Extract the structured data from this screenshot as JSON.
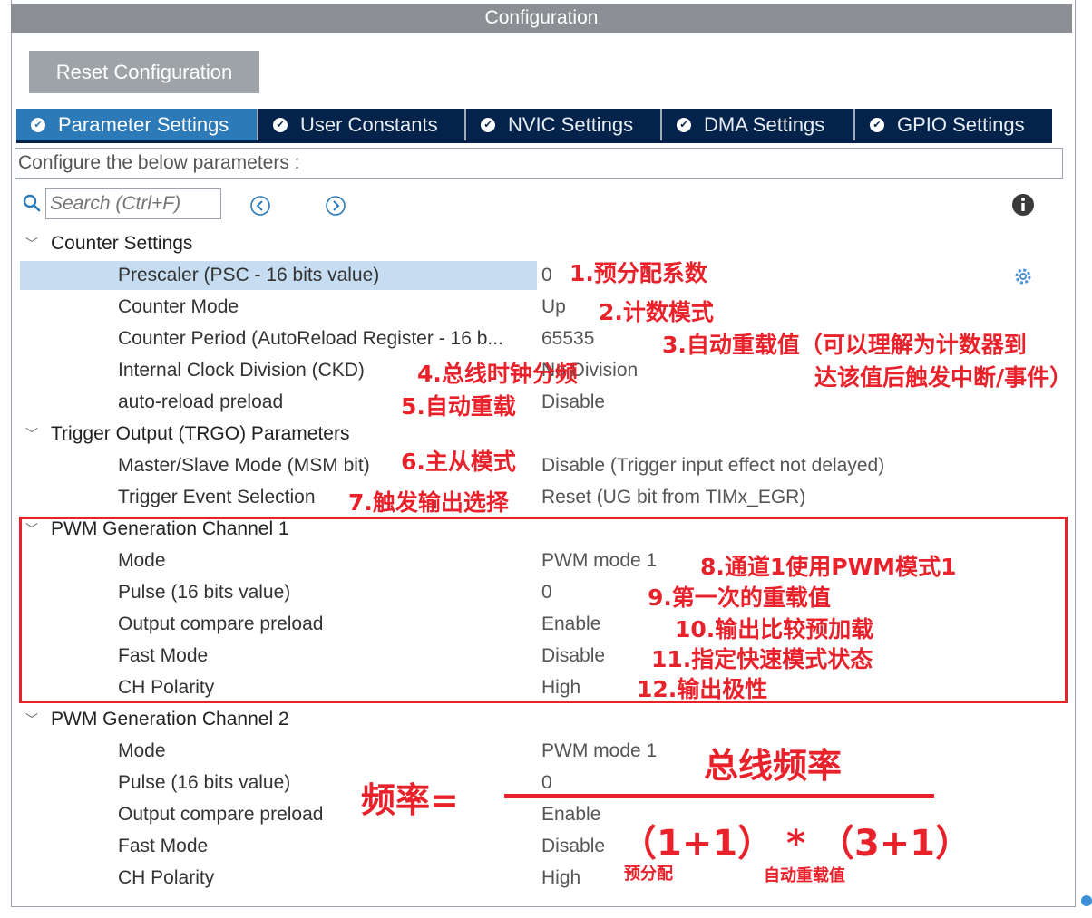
{
  "window": {
    "title": "Configuration"
  },
  "toolbar": {
    "reset_label": "Reset Configuration"
  },
  "tabs": [
    {
      "label": "Parameter Settings",
      "active": true
    },
    {
      "label": "User Constants",
      "active": false
    },
    {
      "label": "NVIC Settings",
      "active": false
    },
    {
      "label": "DMA Settings",
      "active": false
    },
    {
      "label": "GPIO Settings",
      "active": false
    }
  ],
  "config_hint": "Configure the below parameters :",
  "search": {
    "placeholder": "Search (Ctrl+F)"
  },
  "groups": {
    "counter": {
      "title": "Counter Settings",
      "rows": [
        {
          "label": "Prescaler (PSC - 16 bits value)",
          "value": "0"
        },
        {
          "label": "Counter Mode",
          "value": "Up"
        },
        {
          "label": "Counter Period (AutoReload Register - 16 b...",
          "value": "65535"
        },
        {
          "label": "Internal Clock Division (CKD)",
          "value": "No Division"
        },
        {
          "label": "auto-reload preload",
          "value": "Disable"
        }
      ]
    },
    "trgo": {
      "title": "Trigger Output (TRGO) Parameters",
      "rows": [
        {
          "label": "Master/Slave Mode (MSM bit)",
          "value": "Disable (Trigger input effect not delayed)"
        },
        {
          "label": "Trigger Event Selection",
          "value": "Reset (UG bit from TIMx_EGR)"
        }
      ]
    },
    "pwm1": {
      "title": "PWM Generation Channel 1",
      "rows": [
        {
          "label": "Mode",
          "value": "PWM mode 1"
        },
        {
          "label": "Pulse (16 bits value)",
          "value": "0"
        },
        {
          "label": "Output compare preload",
          "value": "Enable"
        },
        {
          "label": "Fast Mode",
          "value": "Disable"
        },
        {
          "label": "CH Polarity",
          "value": "High"
        }
      ]
    },
    "pwm2": {
      "title": "PWM Generation Channel 2",
      "rows": [
        {
          "label": "Mode",
          "value": "PWM mode 1"
        },
        {
          "label": "Pulse (16 bits value)",
          "value": "0"
        },
        {
          "label": "Output compare preload",
          "value": "Enable"
        },
        {
          "label": "Fast Mode",
          "value": "Disable"
        },
        {
          "label": "CH Polarity",
          "value": "High"
        }
      ]
    }
  },
  "annotations": {
    "a1": "1.预分配系数",
    "a2": "2.计数模式",
    "a3_line1": "3.自动重载值（可以理解为计数器到",
    "a3_line2": "达该值后触发中断/事件）",
    "a4": "4.总线时钟分频",
    "a5": "5.自动重载",
    "a6": "6.主从模式",
    "a7": "7.触发输出选择",
    "a8": "8.通道1使用PWM模式1",
    "a9": "9.第一次的重载值",
    "a10": "10.输出比较预加载",
    "a11": "11.指定快速模式状态",
    "a12": "12.输出极性"
  },
  "formula": {
    "lhs": "频率=",
    "numerator": "总线频率",
    "denominator": "（1+1） * （3+1）",
    "label_prescaler": "预分配",
    "label_reload": "自动重载值"
  },
  "colors": {
    "accent_red": "#e8212b",
    "tab_bg": "#03234b",
    "tab_active": "#2d7ab9",
    "selected_row": "#c6dcf0"
  }
}
